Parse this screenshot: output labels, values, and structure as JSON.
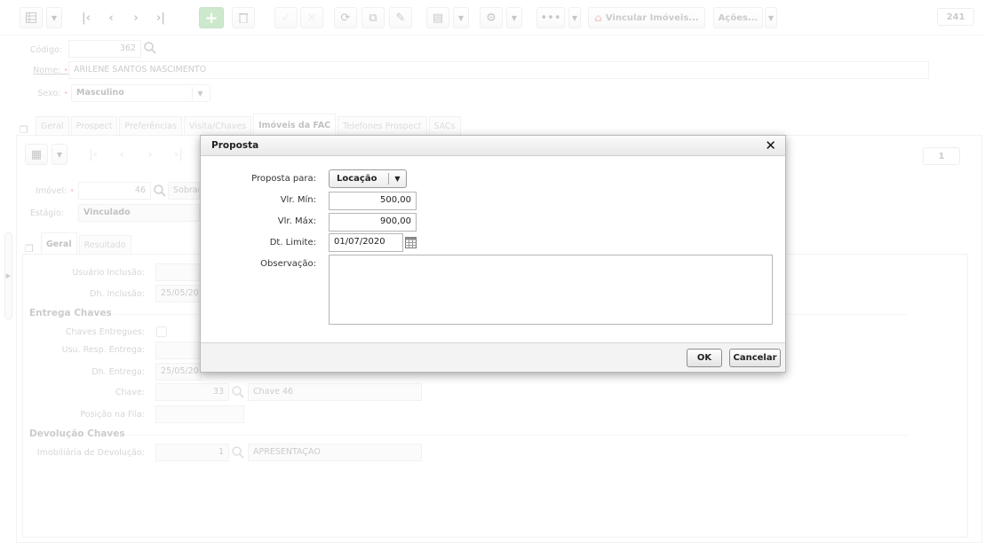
{
  "toolbar": {
    "vincular_label": "Vincular Imóveis...",
    "acoes_label": "Ações...",
    "record_counter": "241"
  },
  "form": {
    "codigo_label": "Código:",
    "codigo_value": "362",
    "nome_label": "Nome:",
    "nome_value": "ARILENE SANTOS NASCIMENTO",
    "sexo_label": "Sexo:",
    "sexo_value": "Masculino"
  },
  "main_tabs": [
    "Geral",
    "Prospect",
    "Preferências",
    "Visita/Chaves",
    "Imóveis da FAC",
    "Telefones Prospect",
    "SACs"
  ],
  "sub": {
    "record_counter": "1",
    "imovel_label": "Imóvel:",
    "imovel_value": "46",
    "imovel_desc": "Sobrad",
    "estagio_label": "Estágio:",
    "estagio_value": "Vinculado",
    "tabs": [
      "Geral",
      "Resultado"
    ]
  },
  "detail": {
    "usuario_inclusao_label": "Usuário Inclusão:",
    "dh_inclusao_label": "Dh. Inclusão:",
    "dh_inclusao_value": "25/05/20",
    "entrega_section": "Entrega Chaves",
    "chaves_entregues_label": "Chaves Entregues:",
    "usu_resp_label": "Usu. Resp. Entrega:",
    "dh_entrega_label": "Dh. Entrega:",
    "dh_entrega_value": "25/05/20",
    "chave_label": "Chave:",
    "chave_code": "33",
    "chave_desc": "Chave 46",
    "posicao_label": "Posição na Fila:",
    "devolucao_section": "Devolução Chaves",
    "imobiliaria_label": "Imobiliária de Devolução:",
    "imobiliaria_code": "1",
    "imobiliaria_desc": "APRESENTAÇAO"
  },
  "dialog": {
    "title": "Proposta",
    "close_glyph": "✕",
    "proposta_label": "Proposta para:",
    "proposta_value": "Locação",
    "vlr_min_label": "Vlr. Mín:",
    "vlr_min_value": "500,00",
    "vlr_max_label": "Vlr. Máx:",
    "vlr_max_value": "900,00",
    "dt_limite_label": "Dt. Limite:",
    "dt_limite_value": "01/07/2020",
    "observacao_label": "Observação:",
    "observacao_value": "",
    "ok_label": "OK",
    "cancel_label": "Cancelar"
  },
  "colors": {
    "add_button": "#5cb85c",
    "required_marker": "#e05a5a"
  }
}
